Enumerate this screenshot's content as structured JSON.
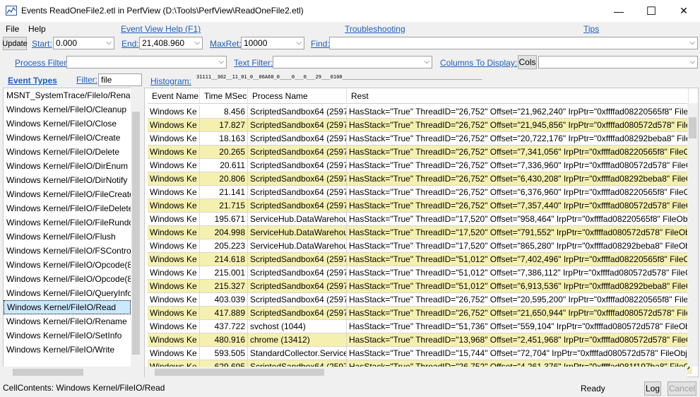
{
  "window": {
    "title": "Events ReadOneFile2.etl in PerfView (D:\\Tools\\PerfView\\ReadOneFile2.etl)",
    "minimize": "—",
    "maximize": "☐",
    "close": "✕"
  },
  "menu": {
    "file": "File",
    "help": "Help"
  },
  "toolbar": {
    "event_view_help": "Event View Help (F1)",
    "troubleshooting": "Troubleshooting",
    "tips": "Tips",
    "update": "Update",
    "start_label": "Start:",
    "start_value": "0.000",
    "end_label": "End:",
    "end_value": "21,408.960",
    "maxret_label": "MaxRet:",
    "maxret_value": "10000",
    "find_label": "Find:",
    "find_value": "",
    "process_filter_label": "Process Filter:",
    "process_filter_value": "",
    "text_filter_label": "Text Filter:",
    "text_filter_value": "",
    "columns_label": "Columns To Display:",
    "cols_button": "Cols",
    "columns_value": ""
  },
  "left": {
    "event_types_label": "Event Types",
    "filter_label": "Filter:",
    "filter_value": "file",
    "items": [
      "MSNT_SystemTrace/FileIo/Renam",
      "Windows Kernel/FileIO/Cleanup",
      "Windows Kernel/FileIO/Close",
      "Windows Kernel/FileIO/Create",
      "Windows Kernel/FileIO/Delete",
      "Windows Kernel/FileIO/DirEnum",
      "Windows Kernel/FileIO/DirNotify",
      "Windows Kernel/FileIO/FileCreate",
      "Windows Kernel/FileIO/FileDelete",
      "Windows Kernel/FileIO/FileRundo",
      "Windows Kernel/FileIO/Flush",
      "Windows Kernel/FileIO/FSControl",
      "Windows Kernel/FileIO/Opcode(8",
      "Windows Kernel/FileIO/Opcode(8",
      "Windows Kernel/FileIO/QueryInfo",
      "Windows Kernel/FileIO/Read",
      "Windows Kernel/FileIO/Rename",
      "Windows Kernel/FileIO/SetInfo",
      "Windows Kernel/FileIO/Write"
    ],
    "selected_index": 15
  },
  "histogram": {
    "label": "Histogram:",
    "value": "31111__302__11_01_0__06A60_0____0___0___29___0100_______________________________________________"
  },
  "grid": {
    "columns": [
      "Event Name",
      "Time MSec",
      "Process Name",
      "Rest"
    ],
    "rows": [
      [
        "Windows Ke",
        "8.456",
        "ScriptedSandbox64 (2597",
        "HasStack=\"True\" ThreadID=\"26,752\" Offset=\"21,962,240\" IrpPtr=\"0xffffad08220565f8\" FileO"
      ],
      [
        "Windows Ke",
        "17.827",
        "ScriptedSandbox64 (2597",
        "HasStack=\"True\" ThreadID=\"26,752\" Offset=\"21,945,856\" IrpPtr=\"0xffffad080572d578\" File"
      ],
      [
        "Windows Ke",
        "18.163",
        "ScriptedSandbox64 (2597",
        "HasStack=\"True\" ThreadID=\"26,752\" Offset=\"20,722,176\" IrpPtr=\"0xffffad08292beba8\" File"
      ],
      [
        "Windows Ke",
        "20.265",
        "ScriptedSandbox64 (2597",
        "HasStack=\"True\" ThreadID=\"26,752\" Offset=\"7,341,056\" IrpPtr=\"0xffffad08220565f8\" FileO"
      ],
      [
        "Windows Ke",
        "20.611",
        "ScriptedSandbox64 (2597",
        "HasStack=\"True\" ThreadID=\"26,752\" Offset=\"7,336,960\" IrpPtr=\"0xffffad080572d578\" FileC"
      ],
      [
        "Windows Ke",
        "20.806",
        "ScriptedSandbox64 (2597",
        "HasStack=\"True\" ThreadID=\"26,752\" Offset=\"6,430,208\" IrpPtr=\"0xffffad08292beba8\" FileO"
      ],
      [
        "Windows Ke",
        "21.141",
        "ScriptedSandbox64 (2597",
        "HasStack=\"True\" ThreadID=\"26,752\" Offset=\"6,376,960\" IrpPtr=\"0xffffad08220565f8\" FileO"
      ],
      [
        "Windows Ke",
        "21.715",
        "ScriptedSandbox64 (2597",
        "HasStack=\"True\" ThreadID=\"26,752\" Offset=\"7,357,440\" IrpPtr=\"0xffffad080572d578\" FileC"
      ],
      [
        "Windows Ke",
        "195.671",
        "ServiceHub.DataWarehou",
        "HasStack=\"True\" ThreadID=\"17,520\" Offset=\"958,464\" IrpPtr=\"0xffffad08220565f8\" FileObj"
      ],
      [
        "Windows Ke",
        "204.998",
        "ServiceHub.DataWarehou",
        "HasStack=\"True\" ThreadID=\"17,520\" Offset=\"791,552\" IrpPtr=\"0xffffad080572d578\" FileOb"
      ],
      [
        "Windows Ke",
        "205.223",
        "ServiceHub.DataWarehou",
        "HasStack=\"True\" ThreadID=\"17,520\" Offset=\"865,280\" IrpPtr=\"0xffffad08292beba8\" FileOb"
      ],
      [
        "Windows Ke",
        "214.618",
        "ScriptedSandbox64 (2597",
        "HasStack=\"True\" ThreadID=\"51,012\" Offset=\"7,402,496\" IrpPtr=\"0xffffad08220565f8\" FileO"
      ],
      [
        "Windows Ke",
        "215.001",
        "ScriptedSandbox64 (2597",
        "HasStack=\"True\" ThreadID=\"51,012\" Offset=\"7,386,112\" IrpPtr=\"0xffffad080572d578\" FileC"
      ],
      [
        "Windows Ke",
        "215.327",
        "ScriptedSandbox64 (2597",
        "HasStack=\"True\" ThreadID=\"51,012\" Offset=\"6,913,536\" IrpPtr=\"0xffffad08292beba8\" FileO"
      ],
      [
        "Windows Ke",
        "403.039",
        "ScriptedSandbox64 (2597",
        "HasStack=\"True\" ThreadID=\"26,752\" Offset=\"20,595,200\" IrpPtr=\"0xffffad08220565f8\" FileC"
      ],
      [
        "Windows Ke",
        "417.889",
        "ScriptedSandbox64 (2597",
        "HasStack=\"True\" ThreadID=\"26,752\" Offset=\"21,650,944\" IrpPtr=\"0xffffad080572d578\" File"
      ],
      [
        "Windows Ke",
        "437.722",
        "svchost (1044)",
        "HasStack=\"True\" ThreadID=\"51,736\" Offset=\"559,104\" IrpPtr=\"0xffffad080572d578\" FileOb"
      ],
      [
        "Windows Ke",
        "480.916",
        "chrome (13412)",
        "HasStack=\"True\" ThreadID=\"13,968\" Offset=\"2,451,968\" IrpPtr=\"0xffffad080572d578\" FileO"
      ],
      [
        "Windows Ke",
        "593.505",
        "StandardCollector.Service",
        "HasStack=\"True\" ThreadID=\"15,744\" Offset=\"72,704\" IrpPtr=\"0xffffad080572d578\" FileObje"
      ],
      [
        "Windows Ke",
        "629.695",
        "ScriptedSandbox64 (2597",
        "HasStack=\"True\" ThreadID=\"26,752\" Offset=\"4,261,376\" IrpPtr=\"0xffffad081f197ba8\" FileO"
      ]
    ]
  },
  "status": {
    "cell_contents": "CellContents: Windows Kernel/FileIO/Read",
    "state": "Ready",
    "log_button": "Log",
    "cancel_button": "Cancel"
  },
  "colors": {
    "link": "#1f5fbf",
    "row_highlight": "#f5f0b0",
    "selection": "#cce8ff"
  }
}
